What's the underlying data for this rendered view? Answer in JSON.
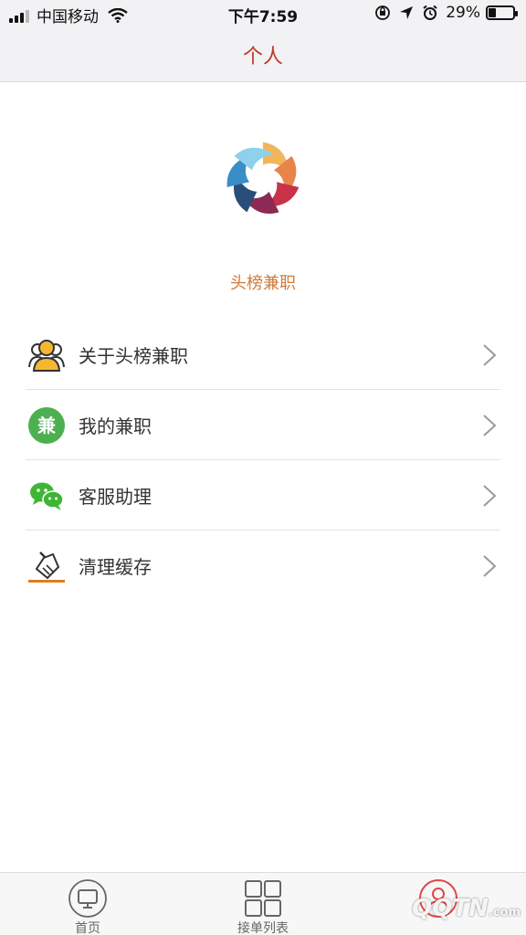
{
  "status_bar": {
    "carrier": "中国移动",
    "time": "下午7:59",
    "battery_percent_text": "29%",
    "battery_level": 0.29
  },
  "nav": {
    "title": "个人"
  },
  "profile": {
    "app_name": "头榜兼职",
    "logo_icon": "pinwheel-logo"
  },
  "menu": {
    "items": [
      {
        "label": "关于头榜兼职",
        "icon": "users-icon"
      },
      {
        "label": "我的兼职",
        "icon": "jian-badge-icon",
        "badge_text": "兼"
      },
      {
        "label": "客服助理",
        "icon": "wechat-icon"
      },
      {
        "label": "清理缓存",
        "icon": "broom-icon"
      }
    ]
  },
  "tab_bar": {
    "tabs": [
      {
        "label": "首页",
        "icon": "monitor-icon"
      },
      {
        "label": "接单列表",
        "icon": "grid-icon"
      },
      {
        "label": "",
        "icon": "user-circle-icon",
        "active": true
      }
    ]
  },
  "watermark": {
    "text": "QQTN",
    "suffix": ".com"
  },
  "colors": {
    "accent": "#c0392b",
    "app_name": "#d17a3a",
    "jian_green": "#4caf50",
    "wechat_green": "#3fb536"
  }
}
